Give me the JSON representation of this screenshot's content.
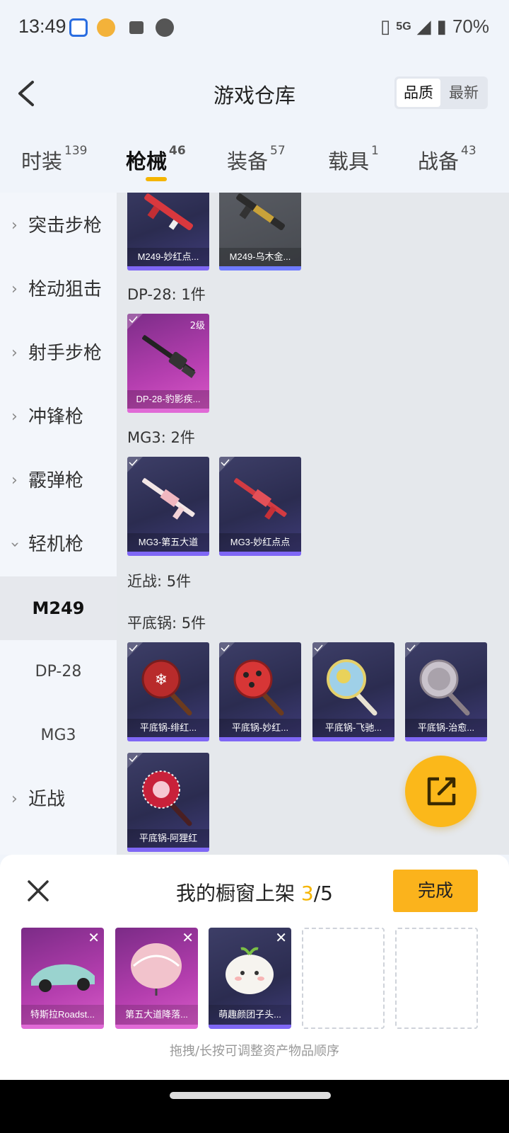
{
  "status": {
    "time": "13:49",
    "network": "5G",
    "battery": "70%"
  },
  "header": {
    "title": "游戏仓库",
    "sort": [
      "品质",
      "最新"
    ]
  },
  "tabs": [
    {
      "label": "时装",
      "count": "139"
    },
    {
      "label": "枪械",
      "count": "46"
    },
    {
      "label": "装备",
      "count": "57"
    },
    {
      "label": "载具",
      "count": "1"
    },
    {
      "label": "战备",
      "count": "43"
    }
  ],
  "sidebar": {
    "categories": [
      "突击步枪",
      "栓动狙击",
      "射手步枪",
      "冲锋枪",
      "霰弹枪",
      "轻机枪"
    ],
    "subs": [
      "M249",
      "DP-28",
      "MG3"
    ],
    "after": "近战"
  },
  "main": {
    "top_cards": [
      "M249-妙红点...",
      "M249-乌木金..."
    ],
    "groups": {
      "dp28": {
        "title": "DP-28: 1件",
        "cards": [
          "DP-28-豹影疾..."
        ],
        "level": "2级"
      },
      "mg3": {
        "title": "MG3: 2件",
        "cards": [
          "MG3-第五大道",
          "MG3-妙红点点"
        ]
      },
      "melee": {
        "title": "近战: 5件"
      },
      "pan": {
        "title": "平底锅: 5件",
        "cards": [
          "平底锅-绯红...",
          "平底锅-妙红...",
          "平底锅-飞驰...",
          "平底锅-治愈...",
          "平底锅-阿狸红"
        ]
      }
    }
  },
  "panel": {
    "title_prefix": "我的橱窗上架 ",
    "count": "3",
    "total": "/5",
    "done": "完成",
    "slots": [
      "特斯拉Roadst...",
      "第五大道降落...",
      "萌趣颜团子头..."
    ],
    "hint": "拖拽/长按可调整资产物品顺序"
  },
  "colors": {
    "accent": "#fbb31c",
    "indicator": "#f5b500"
  }
}
